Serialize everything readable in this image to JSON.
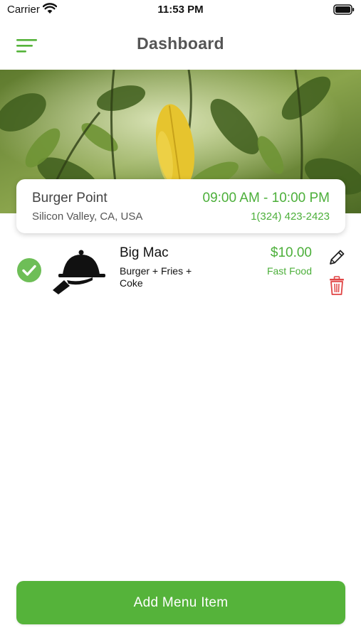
{
  "status_bar": {
    "carrier": "Carrier",
    "time": "11:53 PM"
  },
  "nav": {
    "title": "Dashboard",
    "menu_icon": "hamburger-menu-icon"
  },
  "hero": {
    "description": "foliage-photo"
  },
  "restaurant": {
    "name": "Burger Point",
    "hours": "09:00 AM - 10:00 PM",
    "address": "Silicon Valley, CA, USA",
    "phone": "1(324) 423-2423"
  },
  "menu_items": [
    {
      "name": "Big Mac",
      "description": "Burger + Fries + Coke",
      "price": "$10.00",
      "category": "Fast Food",
      "selected": true
    }
  ],
  "actions": {
    "add_label": "Add Menu Item"
  },
  "colors": {
    "accent": "#55b33a",
    "accent_text": "#4caf3a",
    "delete": "#e04545",
    "title": "#555555"
  }
}
